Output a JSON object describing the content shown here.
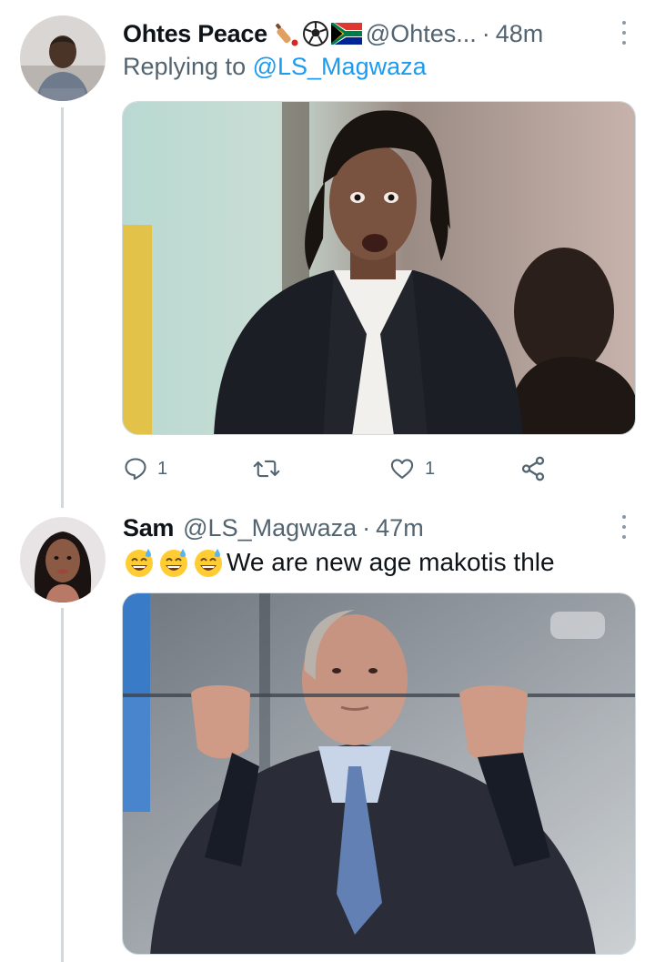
{
  "tweets": [
    {
      "display_name": "Ohtes Peace",
      "name_emojis": [
        "cricket-bat-icon",
        "soccer-ball-icon",
        "south-africa-flag-icon"
      ],
      "handle": "@Ohtes...",
      "separator": "·",
      "time": "48m",
      "replying_label": "Replying to",
      "replying_to": "@LS_Magwaza",
      "media": "photo-man-in-suit-surprised",
      "actions": {
        "reply_count": "1",
        "retweet_count": "",
        "like_count": "1"
      }
    },
    {
      "display_name": "Sam",
      "handle": "@LS_Magwaza",
      "separator": "·",
      "time": "47m",
      "emojis": [
        "sweat-smile-emoji",
        "sweat-smile-emoji",
        "sweat-smile-emoji"
      ],
      "text": "We are new age makotis thle",
      "media": "photo-man-leaning-on-glass"
    }
  ],
  "colors": {
    "text": "#0f1419",
    "secondary": "#536471",
    "link": "#1d9bf0",
    "thread_line": "#cfd9de"
  }
}
